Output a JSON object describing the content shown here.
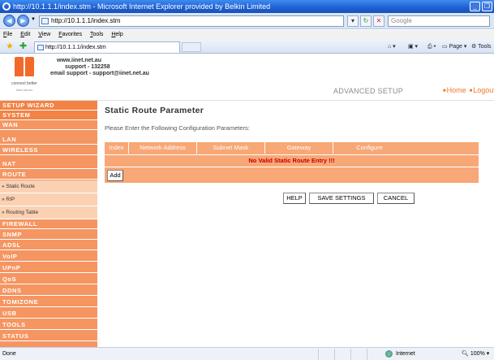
{
  "window": {
    "title": "http://10.1.1.1/index.stm - Microsoft Internet Explorer provided by Belkin Limited"
  },
  "browser": {
    "address": "http://10.1.1.1/index.stm",
    "search_placeholder": "Google",
    "menu": [
      "File",
      "Edit",
      "View",
      "Favorites",
      "Tools",
      "Help"
    ],
    "tab_title": "http://10.1.1.1/index.stm",
    "toolbar_right": {
      "page": "Page",
      "tools": "Tools"
    },
    "status": {
      "left": "Done",
      "zone": "Internet",
      "zoom": "100%"
    }
  },
  "header": {
    "website": "www.iinet.net.au",
    "support_phone": "support - 132258",
    "support_email": "email support - support@iinet.net.au",
    "logo_tagline": "connect better",
    "logo_url": "iinet.net.au",
    "section_title": "ADVANCED SETUP",
    "links": {
      "home": "Home",
      "logout": "Logout"
    }
  },
  "sidebar": {
    "items": [
      "SETUP WIZARD",
      "SYSTEM",
      "WAN",
      "LAN",
      "WIRELESS",
      "NAT",
      "ROUTE"
    ],
    "route_subitems": [
      "» Static Route",
      "» RIP",
      "» Routing Table"
    ],
    "items_after": [
      "FIREWALL",
      "SNMP",
      "ADSL",
      "VoIP",
      "UPnP",
      "QoS",
      "DDNS",
      "TOMIZONE",
      "USB",
      "TOOLS",
      "STATUS"
    ]
  },
  "main": {
    "title": "Static Route Parameter",
    "instructions": "Please Enter the Following Configuration Parameters:",
    "table": {
      "columns": [
        "Index",
        "Network Address",
        "Subnet Mask",
        "Gateway",
        "Configure"
      ],
      "empty_message": "No Valid Static Route Entry !!!",
      "add_label": "Add"
    },
    "buttons": {
      "help": "HELP",
      "save": "SAVE SETTINGS",
      "cancel": "CANCEL"
    }
  },
  "colors": {
    "brand_orange": "#f26a2a",
    "sidebar_bg": "#f59561",
    "table_bg": "#f8a776",
    "error_text": "#c00000"
  }
}
